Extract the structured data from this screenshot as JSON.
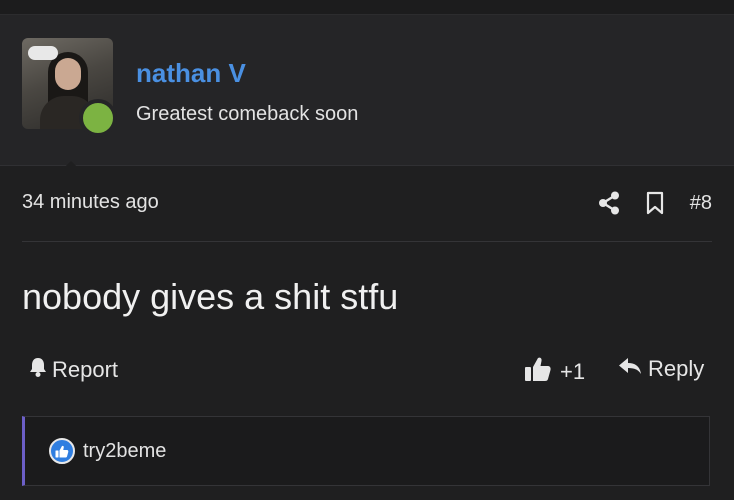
{
  "user": {
    "name": "nathan V",
    "title": "Greatest comeback soon",
    "status_color": "#7cb342",
    "name_color": "#4a90e2"
  },
  "post": {
    "time": "34 minutes ago",
    "number": "#8",
    "body": "nobody gives a shit stfu",
    "share_icon": "share-icon",
    "bookmark_icon": "bookmark-icon"
  },
  "actions": {
    "report_label": "Report",
    "like_count": "+1",
    "reply_label": "Reply"
  },
  "reactions": {
    "users": "try2beme",
    "accent": "#6c5fc7"
  }
}
